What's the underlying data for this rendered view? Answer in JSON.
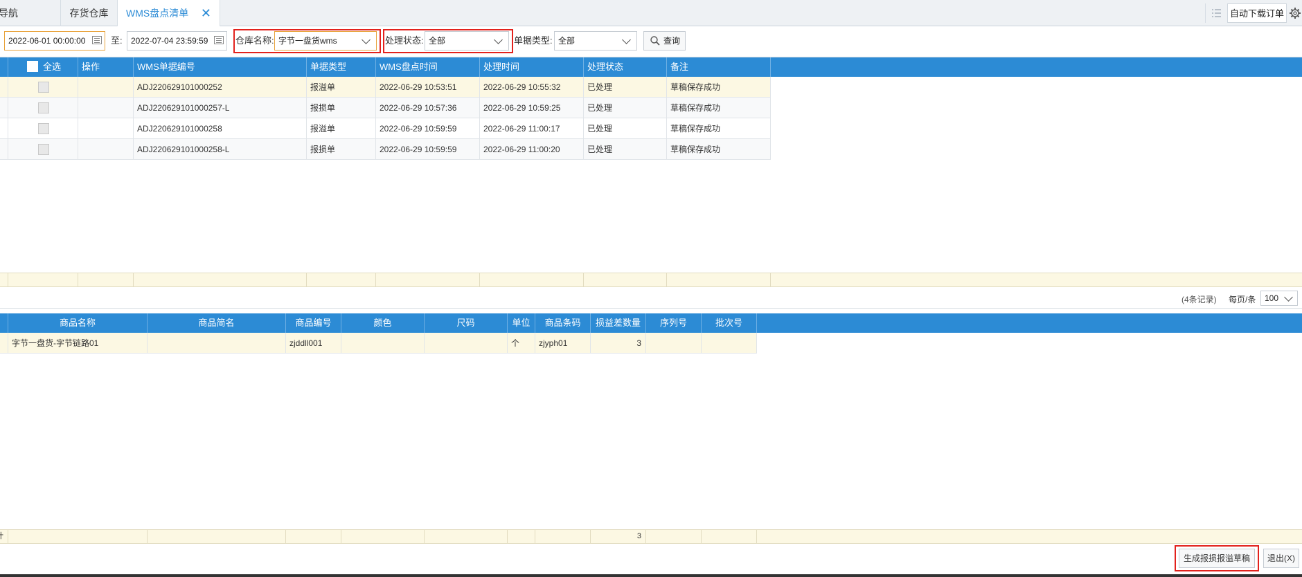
{
  "tabs": [
    {
      "label": "导航"
    },
    {
      "label": "存货仓库"
    },
    {
      "label": "WMS盘点清单"
    }
  ],
  "top_right": {
    "auto_download": "自动下载订单"
  },
  "toolbar": {
    "start_date": "2022-06-01 00:00:00",
    "to_label": "至:",
    "end_date": "2022-07-04 23:59:59",
    "warehouse_label": "仓库名称:",
    "warehouse_value": "字节一盘货wms",
    "status_label": "处理状态:",
    "status_value": "全部",
    "doc_type_label": "单据类型:",
    "doc_type_value": "全部",
    "query_button": "查询"
  },
  "top_grid": {
    "columns": [
      "全选",
      "操作",
      "WMS单据编号",
      "单据类型",
      "WMS盘点时间",
      "处理时间",
      "处理状态",
      "备注"
    ],
    "rows": [
      {
        "doc_no": "ADJ220629101000252",
        "type": "报溢单",
        "check_time": "2022-06-29 10:53:51",
        "process_time": "2022-06-29 10:55:32",
        "status": "已处理",
        "remark": "草稿保存成功"
      },
      {
        "doc_no": "ADJ220629101000257-L",
        "type": "报损单",
        "check_time": "2022-06-29 10:57:36",
        "process_time": "2022-06-29 10:59:25",
        "status": "已处理",
        "remark": "草稿保存成功"
      },
      {
        "doc_no": "ADJ220629101000258",
        "type": "报溢单",
        "check_time": "2022-06-29 10:59:59",
        "process_time": "2022-06-29 11:00:17",
        "status": "已处理",
        "remark": "草稿保存成功"
      },
      {
        "doc_no": "ADJ220629101000258-L",
        "type": "报损单",
        "check_time": "2022-06-29 10:59:59",
        "process_time": "2022-06-29 11:00:20",
        "status": "已处理",
        "remark": "草稿保存成功"
      }
    ]
  },
  "pager": {
    "records": "(4条记录)",
    "per_page_label": "每页/条",
    "per_page_value": "100"
  },
  "bottom_grid": {
    "columns": [
      "商品名称",
      "商品简名",
      "商品编号",
      "颜色",
      "尺码",
      "单位",
      "商品条码",
      "损益差数量",
      "序列号",
      "批次号"
    ],
    "rows": [
      {
        "name": "字节一盘货-字节链路01",
        "short_name": "",
        "code": "zjddll001",
        "color": "",
        "size": "",
        "unit": "个",
        "barcode": "zjyph01",
        "diff_qty": "3",
        "serial": "",
        "batch": ""
      }
    ],
    "sum_label": "计",
    "sum_qty": "3"
  },
  "footer": {
    "generate_button": "生成报损报溢草稿",
    "exit_button": "退出(X)"
  },
  "colors": {
    "header_blue": "#2c8bd5",
    "highlight": "#e2211c",
    "tab_active": "#2b8bd6",
    "summary_bg": "#fcf8e3"
  }
}
